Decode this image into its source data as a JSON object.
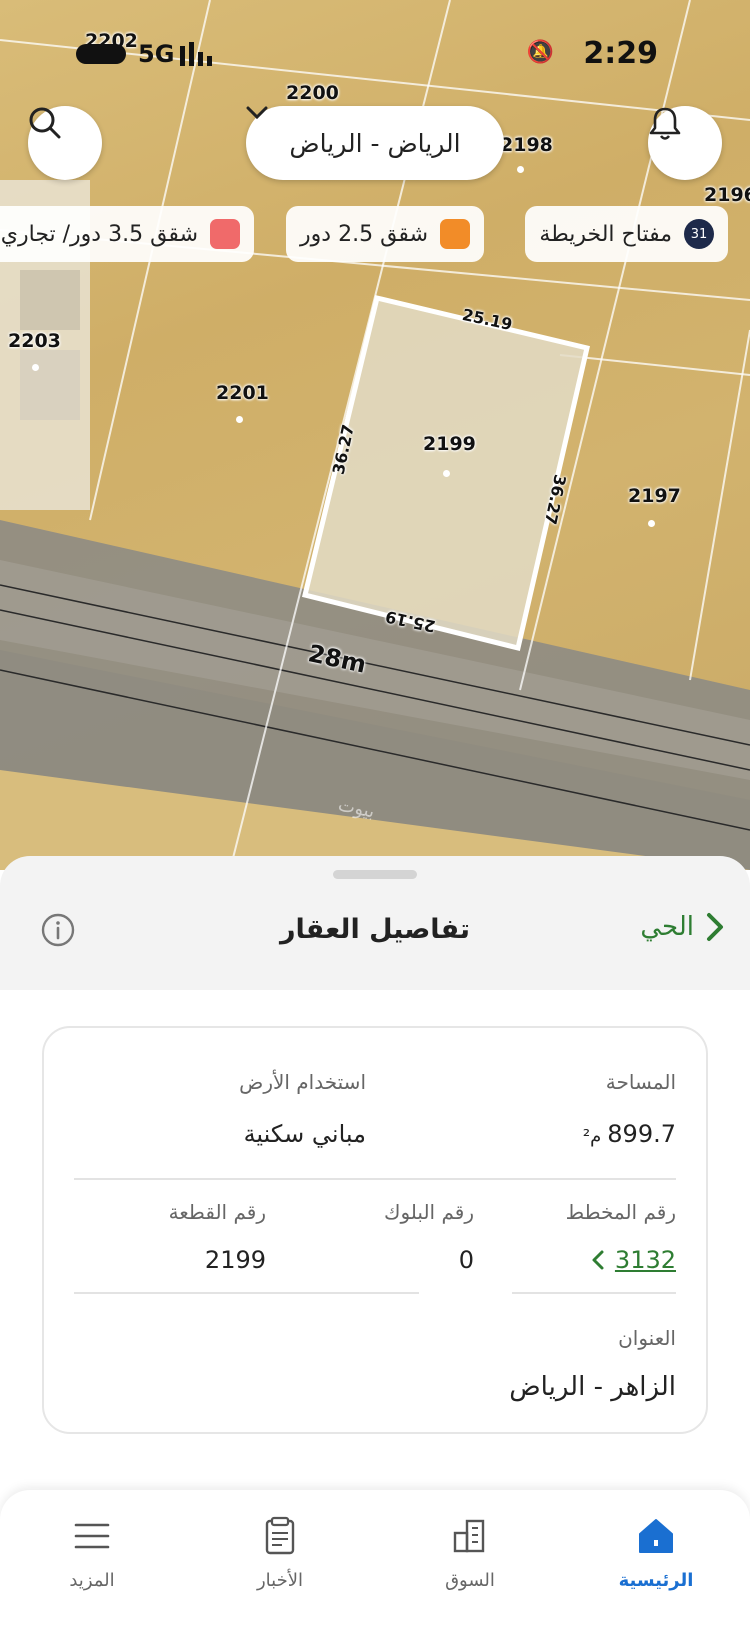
{
  "status_bar": {
    "time": "2:29",
    "network": "5G"
  },
  "header": {
    "city_label": "الرياض - الرياض"
  },
  "legend": {
    "map_key_label": "مفتاح الخريطة",
    "map_key_badge": "31",
    "chips": [
      {
        "label": "شقق 2.5 دور",
        "color": "#f28c28"
      },
      {
        "label": "شقق 3.5 دور/ تجاري",
        "color": "#f06a6a"
      }
    ]
  },
  "map": {
    "plot_labels": [
      "2202",
      "2200",
      "2198",
      "2196",
      "2203",
      "2201",
      "2199",
      "2197"
    ],
    "dimensions": {
      "top": "25.19",
      "bottom": "25.19",
      "left": "36.27",
      "right": "36.27"
    },
    "road_label": "28m",
    "watermark": "بيوت"
  },
  "sheet": {
    "title": "تفاصيل العقار",
    "district_label": "الحي"
  },
  "details": {
    "area_label": "المساحة",
    "area_value": "899.7",
    "area_unit": "م²",
    "land_use_label": "استخدام الأرض",
    "land_use_value": "مباني سكنية",
    "plan_label": "رقم المخطط",
    "plan_value": "3132",
    "block_label": "رقم البلوك",
    "block_value": "0",
    "plot_label": "رقم القطعة",
    "plot_value": "2199",
    "address_label": "العنوان",
    "address_value": "الزاهر - الرياض"
  },
  "nav": {
    "home": "الرئيسية",
    "market": "السوق",
    "news": "الأخبار",
    "more": "المزيد",
    "active_color": "#1a6fd1"
  },
  "colors": {
    "accent_green": "#2e7d32",
    "plot_outline": "#ffffff"
  }
}
